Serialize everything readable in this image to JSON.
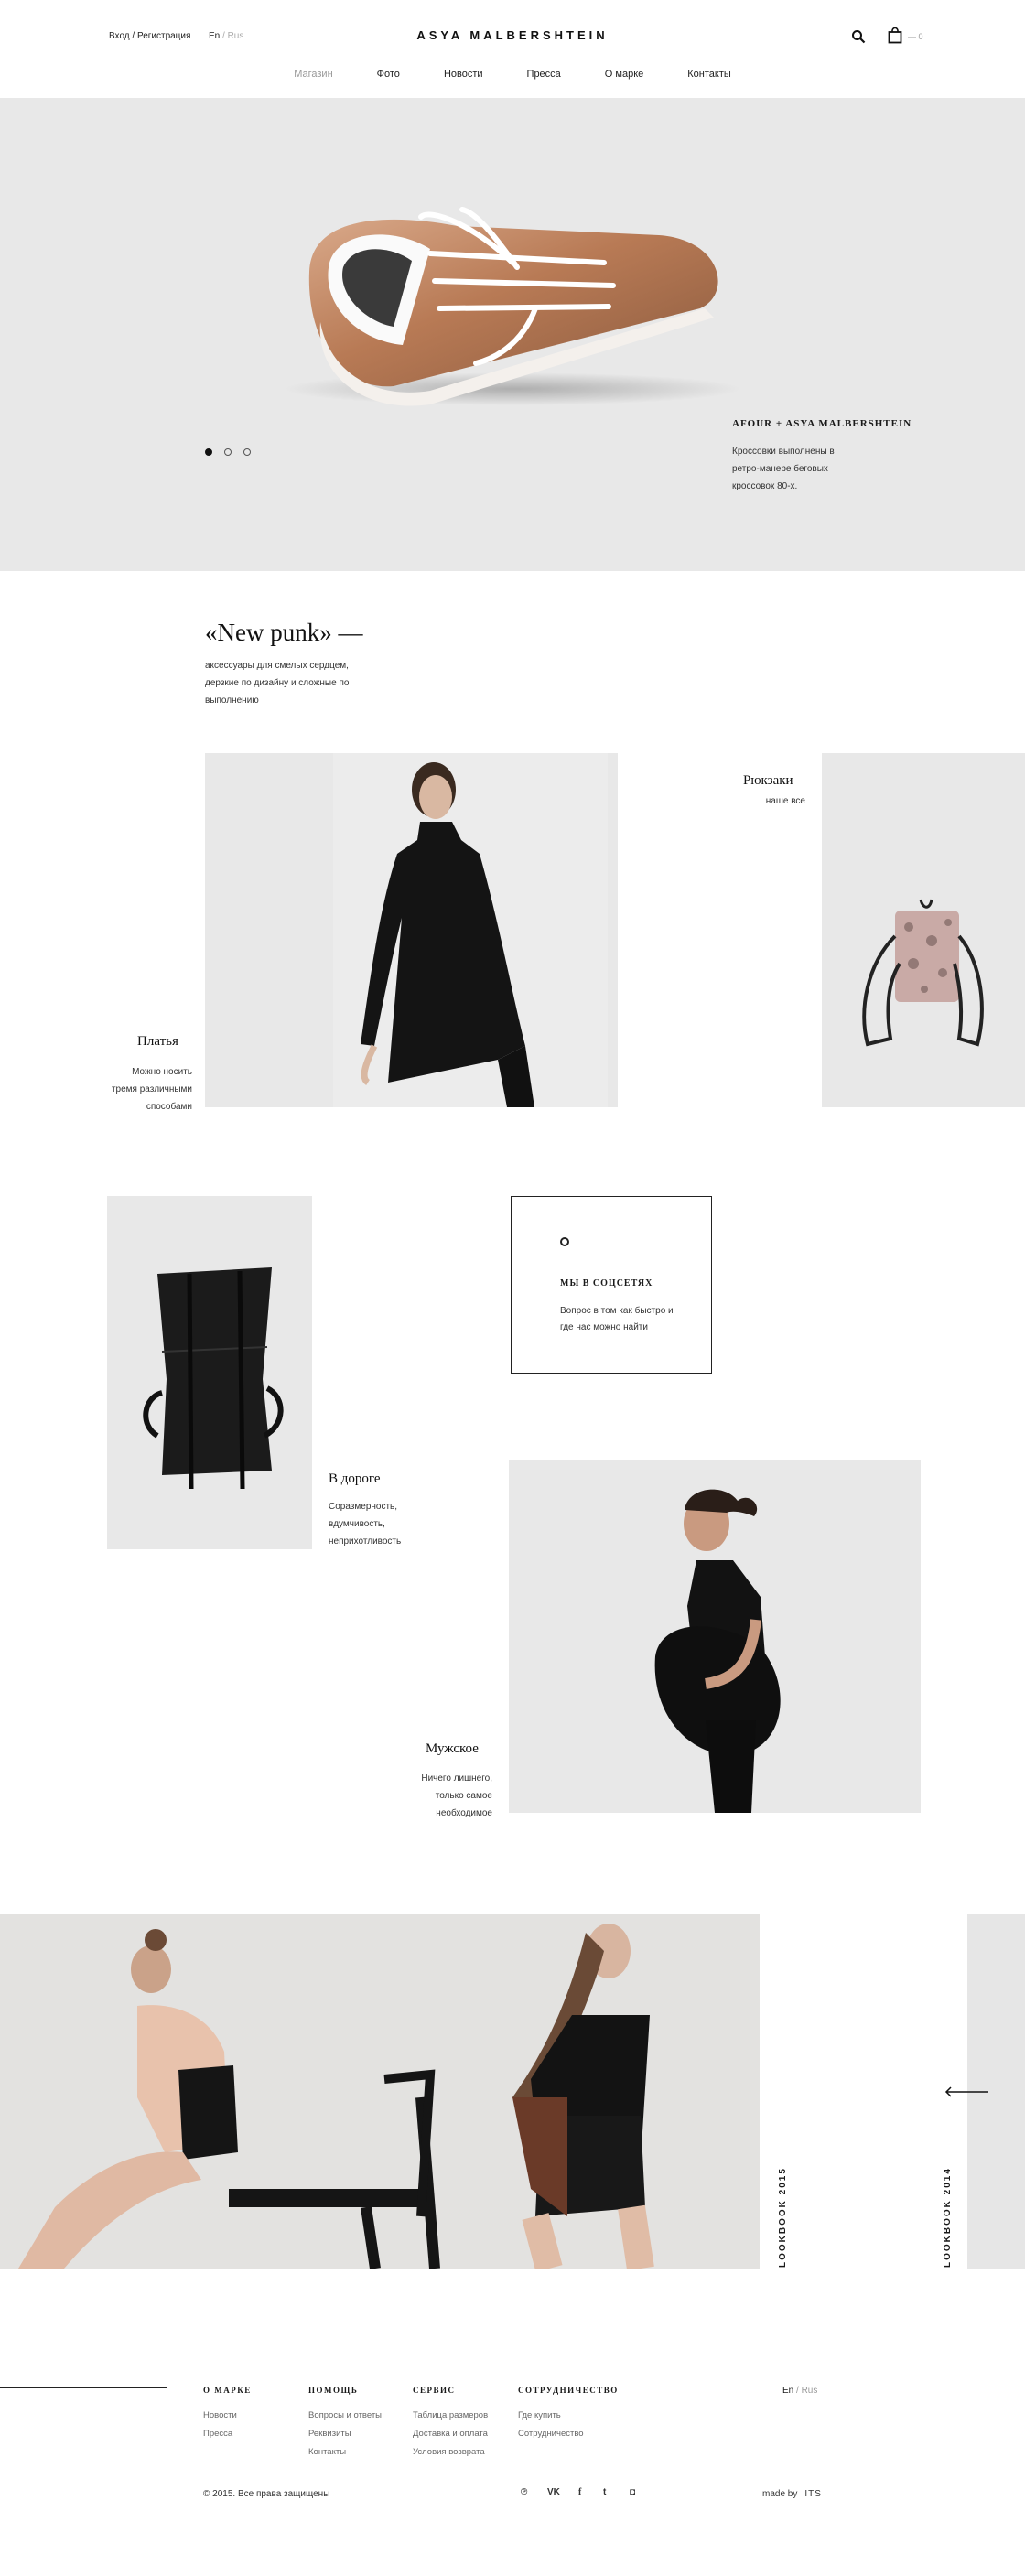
{
  "header": {
    "login": "Вход / Регистрация",
    "lang_active": "En",
    "lang_sep": " / ",
    "lang_other": "Rus",
    "logo": "ASYA MALBERSHTEIN",
    "cart_count": "— 0"
  },
  "nav": [
    {
      "label": "Магазин",
      "active": true
    },
    {
      "label": "Фото"
    },
    {
      "label": "Новости"
    },
    {
      "label": "Пресса"
    },
    {
      "label": "О марке"
    },
    {
      "label": "Контакты"
    }
  ],
  "hero": {
    "title": "AFOUR + ASYA MALBERSHTEIN",
    "desc": "Кроссовки выполнены в ретро-манере беговых кроссовок 80-х.",
    "slides": 3,
    "active_slide": 1
  },
  "intro": {
    "title": "«New punk» —",
    "subtitle": "аксессуары для смелых сердцем, дерзкие по дизайну и сложные по выполнению"
  },
  "categories": {
    "dresses": {
      "title": "Платья",
      "text": "Можно носить тремя различными способами"
    },
    "backpacks": {
      "title": "Рюкзаки",
      "text": "наше все"
    },
    "travel": {
      "title": "В дороге",
      "text": "Соразмерность, вдумчивость, неприхотливость"
    },
    "men": {
      "title": "Мужское",
      "text": "Ничего лишнего, только самое необходимое"
    }
  },
  "social": {
    "title": "МЫ В СОЦСЕТЯХ",
    "text": "Вопрос в том как быстро и где нас можно найти"
  },
  "lookbook": {
    "current": "LOOKBOOK 2015",
    "previous": "LOOKBOOK 2014"
  },
  "footer": {
    "columns": [
      {
        "title": "О МАРКЕ",
        "links": [
          "Новости",
          "Пресса"
        ]
      },
      {
        "title": "ПОМОЩЬ",
        "links": [
          "Вопросы и ответы",
          "Реквизиты",
          "Контакты"
        ]
      },
      {
        "title": "СЕРВИС",
        "links": [
          "Таблица размеров",
          "Доставка и оплата",
          "Условия возврата"
        ]
      },
      {
        "title": "СОТРУДНИЧЕСТВО",
        "links": [
          "Где купить",
          "Сотрудничество"
        ]
      }
    ],
    "lang_active": "En",
    "lang_sep": " / ",
    "lang_other": "Rus",
    "copyright": "© 2015. Все права защищены",
    "social": [
      "pinterest-icon",
      "vk-icon",
      "facebook-icon",
      "twitter-icon",
      "instagram-icon"
    ],
    "social_glyphs": [
      "℗",
      "VK",
      "f",
      "t",
      "◘"
    ],
    "made_by_label": "made by",
    "made_by": "ITS"
  },
  "colors": {
    "background": "#ffffff",
    "panel": "#e8e8e8",
    "text": "#1a1a1a",
    "muted": "#999999"
  }
}
